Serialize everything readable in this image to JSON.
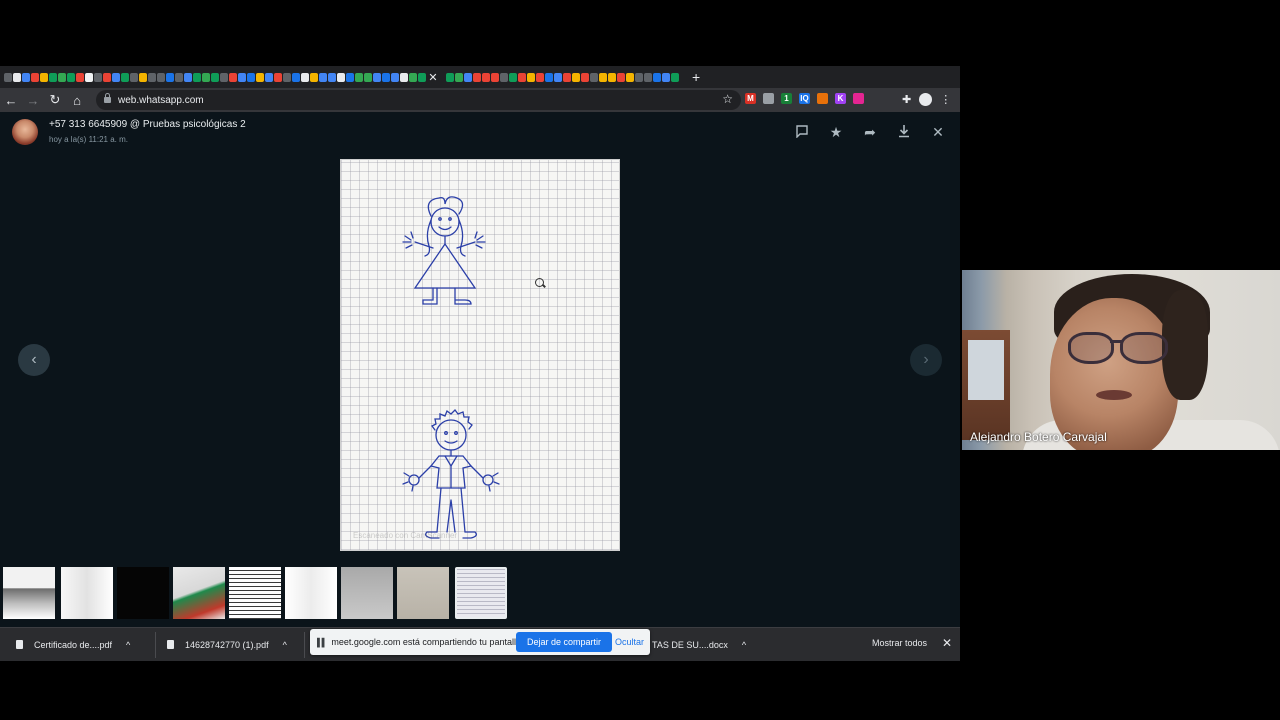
{
  "browser": {
    "url": "web.whatsapp.com",
    "tab_favicons": [
      "#5f6368",
      "#e8eaed",
      "#4285f4",
      "#ea4335",
      "#f4b400",
      "#0f9d58",
      "#34a853",
      "#0f9d58",
      "#ea4335",
      "#f1f3f4",
      "#5f6368",
      "#ea4335",
      "#4285f4",
      "#0f9d58",
      "#5f6368",
      "#f4b400",
      "#5f6368",
      "#5f6368",
      "#1a73e8",
      "#5f6368",
      "#4285f4",
      "#0f9d58",
      "#34a853",
      "#0f9d58",
      "#5f6368",
      "#ea4335",
      "#4285f4",
      "#1a73e8",
      "#f4b400",
      "#4285f4",
      "#ea4335",
      "#5f6368",
      "#1a73e8",
      "#e8eaed",
      "#f4b400",
      "#4285f4",
      "#4285f4",
      "#e8eaed",
      "#1a73e8",
      "#34a853",
      "#34a853",
      "#4285f4",
      "#1a73e8",
      "#4285f4",
      "#e8eaed",
      "#34a853",
      "#0f9d58"
    ],
    "tab_favicons_after": [
      "#0f9d58",
      "#34a853",
      "#4285f4",
      "#ea4335",
      "#ea4335",
      "#ea4335",
      "#5f6368",
      "#0f9d58",
      "#ea4335",
      "#f4b400",
      "#ea4335",
      "#1a73e8",
      "#4285f4",
      "#ea4335",
      "#f4b400",
      "#ea4335",
      "#5f6368",
      "#f4b400",
      "#f4b400",
      "#ea4335",
      "#f4b400",
      "#5f6368",
      "#5f6368",
      "#1a73e8",
      "#4285f4",
      "#0f9d58"
    ],
    "extensions": [
      {
        "icon": "adblock-icon",
        "color": "#d93025",
        "text": "M"
      },
      {
        "icon": "record-icon",
        "color": "#9aa0a6",
        "text": ""
      },
      {
        "icon": "badge-extension-icon",
        "color": "#188038",
        "text": "1"
      },
      {
        "icon": "iq-icon",
        "color": "#1a73e8",
        "text": "IQ"
      },
      {
        "icon": "circle-extension-icon",
        "color": "#e8710a",
        "text": ""
      },
      {
        "icon": "k-extension-icon",
        "color": "#a142f4",
        "text": "K"
      },
      {
        "icon": "grid-extension-icon",
        "color": "#e52592",
        "text": ""
      }
    ]
  },
  "viewer": {
    "sender": "+57 313 6645909 @ Pruebas psicológicas 2",
    "time": "hoy a la(s) 11:21 a. m.",
    "watermark": "Escaneado con CamScanner",
    "thumbnails": [
      {
        "bg": "linear-gradient(180deg,#f2f2f2 0,#f2f2f2 40%,#6d6d6d 42%,#bdbdbd 70%,#ffffff 100%)",
        "selected": false
      },
      {
        "bg": "linear-gradient(90deg,#f7f7f7,#e2e2e2,#ffffff)",
        "selected": false
      },
      {
        "bg": "#050505",
        "selected": false
      },
      {
        "bg": "linear-gradient(160deg,#e9e9e9 0,#d8d8d8 45%,#1f8a4c 50%,#c0392b 80%,#eaeaea 100%)",
        "selected": false
      },
      {
        "bg": "repeating-linear-gradient(180deg,#ffffff 0 3px,#3a3a3a 3px 4px)",
        "selected": false
      },
      {
        "bg": "linear-gradient(90deg,#ffffff,#ececec,#ffffff)",
        "selected": false
      },
      {
        "bg": "linear-gradient(180deg,#a9a9a9,#c9c9c9)",
        "selected": false
      },
      {
        "bg": "linear-gradient(180deg,#c8c3b9,#b8b2a7)",
        "selected": false
      },
      {
        "bg": "repeating-linear-gradient(0deg,#e9e9ef 0 3px,#b9b9c6 3px 4px)",
        "selected": true
      }
    ]
  },
  "downloads": {
    "items": [
      {
        "name": "Certificado de....pdf"
      },
      {
        "name": "14628742770 (1).pdf"
      },
      {
        "name": "TAS DE SU....docx"
      }
    ],
    "show_all": "Mostrar todos"
  },
  "share": {
    "message": "meet.google.com está compartiendo tu pantalla.",
    "stop": "Dejar de compartir",
    "hide": "Ocultar"
  },
  "video": {
    "participant": "Alejandro Botero Carvajal"
  },
  "colors": {
    "viewer_bg": "#0b141a",
    "accent_blue": "#1a73e8",
    "ink": "#2b3fa8"
  }
}
